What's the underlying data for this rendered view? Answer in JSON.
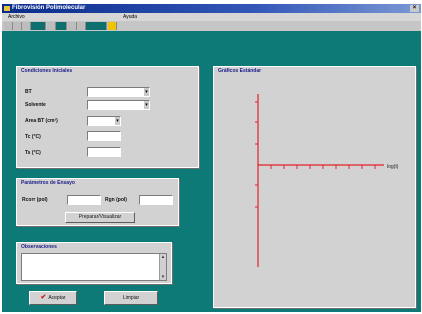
{
  "window": {
    "title": "Fibrovisión Polimolecular",
    "close_glyph": "×"
  },
  "menu": {
    "items": [
      "Archivo",
      "Ayuda"
    ]
  },
  "panels": {
    "conditions": {
      "title": "Condiciones Iniciales",
      "labels": [
        "BT",
        "Solvente",
        "Area BT (cm²)",
        "Tc (°C)",
        "Ts (°C)"
      ]
    },
    "params": {
      "title": "Parámetros de Ensayo",
      "label_1": "Rcorr (pol)",
      "label_2": "Rgn (pol)",
      "button": "Preparar/Visualizar"
    },
    "observations": {
      "title": "Observaciones"
    },
    "graph": {
      "title": "Gráficos Estándar",
      "x_label": "log(t)"
    }
  },
  "buttons": {
    "accept": "Aceptar",
    "clear": "Limpiar"
  },
  "icons": {
    "dropdown": "dropdown-arrow-icon",
    "check": "check-icon",
    "app": "app-icon"
  },
  "colors": {
    "workspace": "#0e7a78",
    "title_text": "#1b1b8a",
    "axis": "#e2222a",
    "check": "#d01a1a"
  }
}
